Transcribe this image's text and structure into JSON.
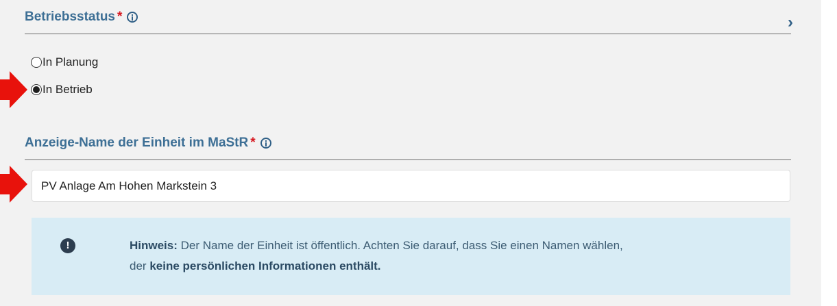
{
  "section1": {
    "title": "Betriebsstatus",
    "required_mark": "*",
    "info_icon": "info-icon"
  },
  "radio_options": [
    {
      "label": "In Planung",
      "checked": false
    },
    {
      "label": "In Betrieb",
      "checked": true
    }
  ],
  "section2": {
    "title": "Anzeige-Name der Einheit im MaStR",
    "required_mark": "*",
    "info_icon": "info-icon"
  },
  "name_field": {
    "value": "PV Anlage Am Hohen Markstein 3"
  },
  "notice": {
    "icon": "exclamation-icon",
    "label": "Hinweis:",
    "text1": "Der Name der Einheit ist öffentlich. Achten Sie darauf, dass Sie einen Namen wählen,",
    "text2a": "der",
    "text2b": "keine persönlichen Informationen enthält."
  },
  "sidebar_toggle_icon": "chevron-right-icon",
  "colors": {
    "heading": "#3d6f95",
    "required": "#d6171f",
    "notice_bg": "#d8ecf5",
    "panel_bg": "#f2f2f2",
    "annotation_arrow": "#e8120c"
  }
}
